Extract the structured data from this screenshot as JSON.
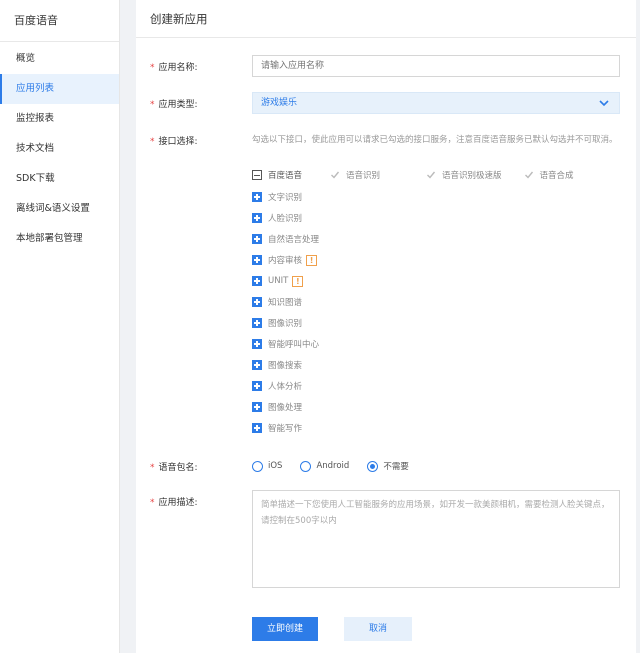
{
  "sidebar": {
    "title": "百度语音",
    "items": [
      {
        "label": "概览"
      },
      {
        "label": "应用列表"
      },
      {
        "label": "监控报表"
      },
      {
        "label": "技术文档"
      },
      {
        "label": "SDK下载"
      },
      {
        "label": "离线词&语义设置"
      },
      {
        "label": "本地部署包管理"
      }
    ]
  },
  "main": {
    "title": "创建新应用",
    "form": {
      "name": {
        "label": "应用名称:",
        "placeholder": "请输入应用名称",
        "value": ""
      },
      "type": {
        "label": "应用类型:",
        "value": "游戏娱乐"
      },
      "api": {
        "label": "接口选择:",
        "hint": "勾选以下接口，使此应用可以请求已勾选的接口服务，注意百度语音服务已默认勾选并不可取消。",
        "baidu_voice": {
          "label": "百度语音",
          "subs": [
            "语音识别",
            "语音识别极速版",
            "语音合成"
          ]
        },
        "groups": [
          {
            "label": "文字识别",
            "warn": false
          },
          {
            "label": "人脸识别",
            "warn": false
          },
          {
            "label": "自然语言处理",
            "warn": false
          },
          {
            "label": "内容审核",
            "warn": true
          },
          {
            "label": "UNIT",
            "warn": true
          },
          {
            "label": "知识图谱",
            "warn": false
          },
          {
            "label": "图像识别",
            "warn": false
          },
          {
            "label": "智能呼叫中心",
            "warn": false
          },
          {
            "label": "图像搜索",
            "warn": false
          },
          {
            "label": "人体分析",
            "warn": false
          },
          {
            "label": "图像处理",
            "warn": false
          },
          {
            "label": "智能写作",
            "warn": false
          }
        ],
        "warn_glyph": "!"
      },
      "package": {
        "label": "语音包名:",
        "options": [
          "iOS",
          "Android",
          "不需要"
        ],
        "selected": "不需要"
      },
      "description": {
        "label": "应用描述:",
        "placeholder": "简单描述一下您使用人工智能服务的应用场景，如开发一款美颜相机，需要检测人脸关键点，请控制在500字以内"
      }
    },
    "buttons": {
      "create": "立即创建",
      "cancel": "取消"
    }
  },
  "colors": {
    "accent": "#2d7ce8",
    "required": "#e64545",
    "warning": "#f0a04b"
  }
}
